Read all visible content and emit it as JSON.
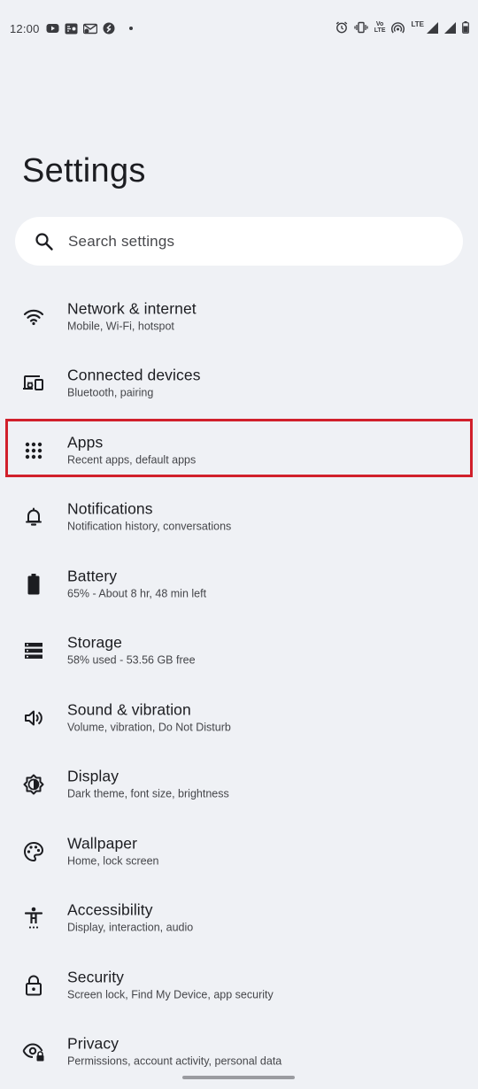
{
  "status_bar": {
    "time": "12:00",
    "left_icons": [
      "youtube-icon",
      "pay-icon",
      "message-icon",
      "shazam-icon",
      "dot-icon"
    ],
    "right_icons": [
      "alarm-icon",
      "vibrate-icon",
      "volte-icon",
      "hotspot-icon",
      "signal-icon",
      "signal-icon",
      "battery-icon"
    ],
    "volte_top": "Vo",
    "volte_bottom": "LTE",
    "lte_label": "LTE"
  },
  "page": {
    "title": "Settings"
  },
  "search": {
    "placeholder": "Search settings"
  },
  "items": [
    {
      "icon": "wifi-icon",
      "title": "Network & internet",
      "subtitle": "Mobile, Wi-Fi, hotspot"
    },
    {
      "icon": "devices-icon",
      "title": "Connected devices",
      "subtitle": "Bluetooth, pairing"
    },
    {
      "icon": "apps-grid-icon",
      "title": "Apps",
      "subtitle": "Recent apps, default apps",
      "highlighted": true
    },
    {
      "icon": "bell-icon",
      "title": "Notifications",
      "subtitle": "Notification history, conversations"
    },
    {
      "icon": "battery-icon",
      "title": "Battery",
      "subtitle": "65% - About 8 hr, 48 min left"
    },
    {
      "icon": "storage-icon",
      "title": "Storage",
      "subtitle": "58% used - 53.56 GB free"
    },
    {
      "icon": "speaker-icon",
      "title": "Sound & vibration",
      "subtitle": "Volume, vibration, Do Not Disturb"
    },
    {
      "icon": "brightness-icon",
      "title": "Display",
      "subtitle": "Dark theme, font size, brightness"
    },
    {
      "icon": "palette-icon",
      "title": "Wallpaper",
      "subtitle": "Home, lock screen"
    },
    {
      "icon": "accessibility-icon",
      "title": "Accessibility",
      "subtitle": "Display, interaction, audio"
    },
    {
      "icon": "lock-icon",
      "title": "Security",
      "subtitle": "Screen lock, Find My Device, app security"
    },
    {
      "icon": "eye-lock-icon",
      "title": "Privacy",
      "subtitle": "Permissions, account activity, personal data"
    }
  ],
  "colors": {
    "background": "#eff1f5",
    "highlight": "#d1202b",
    "text_primary": "#1c1d21",
    "text_secondary": "#45464a"
  }
}
